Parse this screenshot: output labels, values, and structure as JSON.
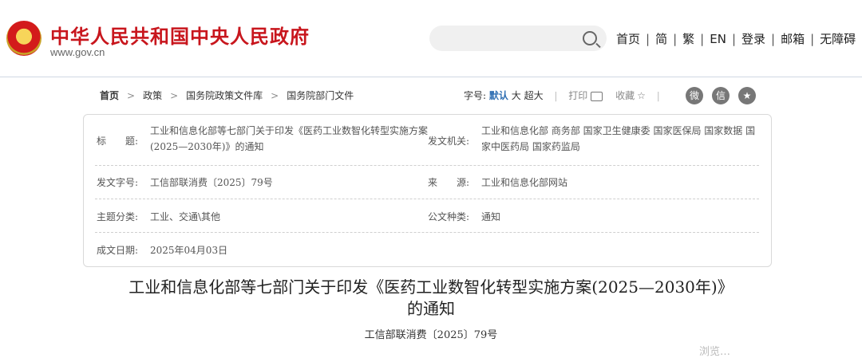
{
  "header": {
    "site_title": "中华人民共和国中央人民政府",
    "site_url": "www.gov.cn",
    "nav": [
      "首页",
      "简",
      "繁",
      "EN",
      "登录",
      "邮箱",
      "无障碍"
    ],
    "nav_separator": "|"
  },
  "breadcrumb": {
    "items": [
      "首页",
      "政策",
      "国务院政策文件库",
      "国务院部门文件"
    ],
    "arrow": ">"
  },
  "tools": {
    "font_label": "字号:",
    "font_default": "默认",
    "font_large": "大",
    "font_xlarge": "超大",
    "print": "打印",
    "favorite": "收藏",
    "divider": "|",
    "star": "☆"
  },
  "share": {
    "weibo": "微",
    "wechat": "信",
    "favorite": "★"
  },
  "meta": {
    "title_label": "标　　题:",
    "title_value": "工业和信息化部等七部门关于印发《医药工业数智化转型实施方案(2025—2030年)》的通知",
    "issuer_label": "发文机关:",
    "issuer_value": "工业和信息化部  商务部  国家卫生健康委  国家医保局  国家数据 国家中医药局  国家药监局",
    "docnum_label": "发文字号:",
    "docnum_value": "工信部联消费〔2025〕79号",
    "source_label": "来　　源:",
    "source_value": "工业和信息化部网站",
    "category_label": "主题分类:",
    "category_value": "工业、交通\\其他",
    "type_label": "公文种类:",
    "type_value": "通知",
    "date_label": "成文日期:",
    "date_value": "2025年04月03日"
  },
  "document": {
    "title_line1": "工业和信息化部等七部门关于印发《医药工业数智化转型实施方案(2025—2030年)》",
    "title_line2": "的通知",
    "number": "工信部联消费〔2025〕79号"
  },
  "footer_faint": "浏览…",
  "colors": {
    "brand_red": "#c8161d",
    "link_blue": "#2f6fb3"
  }
}
